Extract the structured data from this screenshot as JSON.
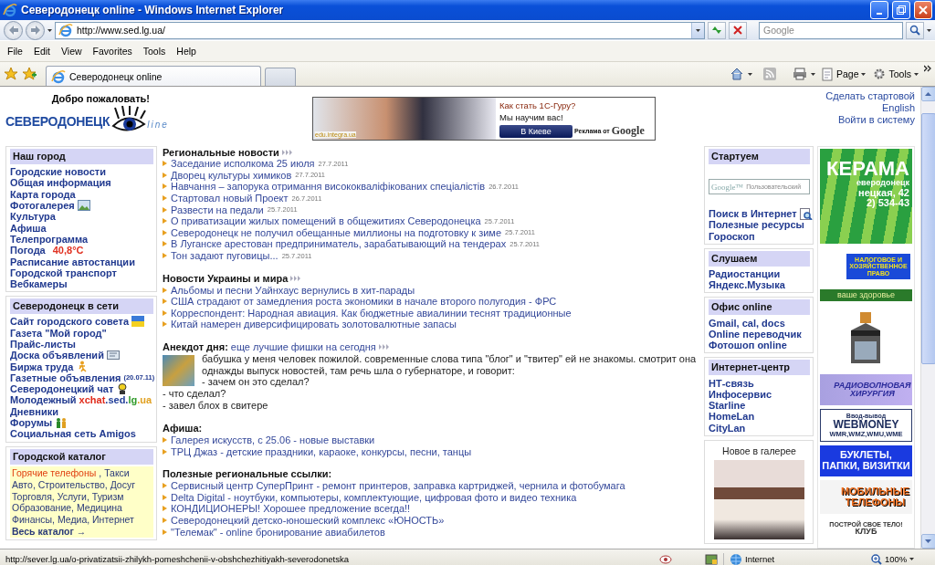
{
  "window": {
    "title": "Северодонецк online - Windows Internet Explorer"
  },
  "address_bar": {
    "url": "http://www.sed.lg.ua/"
  },
  "search": {
    "placeholder": "Google"
  },
  "menu": [
    "File",
    "Edit",
    "View",
    "Favorites",
    "Tools",
    "Help"
  ],
  "tabs": [
    {
      "label": "Северодонецк online",
      "selected": true
    }
  ],
  "command_bar": [
    "Page",
    "Tools"
  ],
  "header": {
    "welcome": "Добро пожаловать!",
    "logo": "СЕВЕРОДОНЕЦК",
    "logo_suffix": "line",
    "ad": {
      "site": "edu.integra.ua",
      "headline": "Как стать 1С-Гуру?",
      "subline": "Мы научим вас!",
      "button": "В Киеве",
      "ads_by": "Реклама от",
      "brand": "Google"
    },
    "links": [
      "Сделать стартовой",
      "English",
      "Войти в систему"
    ]
  },
  "left_sidebar": [
    {
      "title": "Наш город",
      "kind": "links",
      "items": [
        {
          "text": "Городские новости"
        },
        {
          "text": "Общая информация"
        },
        {
          "text": "Карта города"
        },
        {
          "text": "Фотогалерея"
        },
        {
          "text": "Культура"
        },
        {
          "text": "Афиша"
        },
        {
          "text": "Телепрограмма"
        },
        {
          "text": "Погода",
          "value": "40,8°C"
        },
        {
          "text": "Расписание автостанции"
        },
        {
          "text": "Городской транспорт"
        },
        {
          "text": "Вебкамеры"
        }
      ]
    },
    {
      "title": "Северодонецк в сети",
      "kind": "links",
      "items": [
        {
          "text": "Сайт городского совета"
        },
        {
          "text": "Газета \"Мой город\""
        },
        {
          "text": "Прайс-листы"
        },
        {
          "text": "Доска объявлений"
        },
        {
          "text": "Биржа труда"
        },
        {
          "text": "Газетные объявления",
          "note": "(20.07.11)"
        },
        {
          "text": "Северодонецкий чат"
        },
        {
          "text": "Молодежный",
          "parts": [
            {
              "text": "xchat",
              "color": "#e02a1a"
            },
            {
              "text": ".sed.",
              "color": "#23409a"
            },
            {
              "text": "lg",
              "color": "#2f9a2a"
            },
            {
              "text": ".ua",
              "color": "#e0a020"
            }
          ]
        },
        {
          "text": "Дневники"
        },
        {
          "text": "Форумы"
        },
        {
          "text": "Социальная сеть Amigos"
        }
      ]
    },
    {
      "title": "Городской каталог",
      "kind": "catalog",
      "lines": [
        [
          {
            "text": "Горячие телефоны",
            "hot": true
          },
          {
            "text": ", Такси",
            "hot": false
          }
        ],
        [
          {
            "text": "Авто, Строительство, Досуг",
            "hot": false
          }
        ],
        [
          {
            "text": "Торговля, Услуги, Туризм",
            "hot": false
          }
        ],
        [
          {
            "text": "Образование, Медицина",
            "hot": false
          }
        ],
        [
          {
            "text": "Финансы, Медиа, Интернет",
            "hot": false
          }
        ]
      ],
      "all": "Весь каталог →"
    }
  ],
  "center": [
    {
      "title": "Региональные новости",
      "more": true,
      "kind": "news",
      "items": [
        {
          "text": "Заседание исполкома 25 июля",
          "date": "27.7.2011"
        },
        {
          "text": "Дворец культуры химиков",
          "date": "27.7.2011"
        },
        {
          "text": "Навчання – запорука отримання висококваліфікованих спеціалістів",
          "date": "26.7.2011"
        },
        {
          "text": "Стартовал новый Проект",
          "date": "26.7.2011"
        },
        {
          "text": "Развести на педали",
          "date": "25.7.2011"
        },
        {
          "text": "О приватизации жилых помещений в общежитиях Северодонецка",
          "date": "25.7.2011"
        },
        {
          "text": "Северодонецк не получил обещанные миллионы на подготовку к зиме",
          "date": "25.7.2011"
        },
        {
          "text": "В Луганске арестован предприниматель, зарабатывающий на тендерах",
          "date": "25.7.2011"
        },
        {
          "text": "Тон задают пуговицы...",
          "date": "25.7.2011"
        }
      ]
    },
    {
      "title": "Новости Украины и мира",
      "more": true,
      "kind": "news",
      "items": [
        {
          "text": "Альбомы и песни Уайнхаус вернулись в хит-парады"
        },
        {
          "text": "США страдают от замедления роста экономики в начале второго полугодия - ФРС"
        },
        {
          "text": "Корреспондент: Народная авиация. Как бюджетные авиалинии теснят традиционные"
        },
        {
          "text": "Китай намерен диверсифицировать золотовалютные запасы"
        }
      ]
    },
    {
      "title": "Анекдот дня:",
      "more": true,
      "kind": "anecdote",
      "link": "еще лучшие фишки на сегодня",
      "lines": [
        "бабушка у меня человек пожилой. современные слова типа \"блог\" и \"твитер\" ей не знакомы. смотрит она однажды выпуск новостей, там речь шла о губернаторе, и говорит:",
        "- зачем он это сделал?",
        "- что сделал?",
        "- завел блох в свитере"
      ]
    },
    {
      "title": "Афиша:",
      "more": false,
      "kind": "news",
      "items": [
        {
          "text": "Галерея искусств, с 25.06 - новые выставки"
        },
        {
          "text": "ТРЦ Джаз - детские праздники, караоке, конкурсы, песни, танцы"
        }
      ]
    },
    {
      "title": "Полезные региональные ссылки:",
      "more": false,
      "kind": "news",
      "items": [
        {
          "text": "Сервисный центр СуперПринт - ремонт принтеров, заправка картриджей, чернила и фотобумага"
        },
        {
          "text": "Delta Digital - ноутбуки, компьютеры, комплектующие, цифровая фото и видео техника"
        },
        {
          "text": "КОНДИЦИОНЕРЫ! Хорошее предложение всегда!!"
        },
        {
          "text": "Северодонецкий детско-юношеский комплекс «ЮНОСТЬ»"
        },
        {
          "text": "\"Телемак\" - online бронирование авиабилетов"
        }
      ]
    }
  ],
  "right_sidebar": [
    {
      "title": "Стартуем",
      "kind": "search",
      "search": {
        "logo": "Google™",
        "placeholder": "Пользовательский"
      },
      "items": [
        {
          "text": "Поиск в Интернет"
        },
        {
          "text": "Полезные ресурсы"
        },
        {
          "text": "Гороскоп"
        }
      ]
    },
    {
      "title": "Слушаем",
      "kind": "links",
      "items": [
        {
          "text": "Радиостанции"
        },
        {
          "text": "Яндекс.Музыка"
        }
      ]
    },
    {
      "title": "Офис online",
      "kind": "links",
      "items": [
        {
          "text": "Gmail, cal, docs"
        },
        {
          "text": "Online переводчик"
        },
        {
          "text": "Фотошоп online"
        }
      ]
    },
    {
      "title": "Интернет-центр",
      "kind": "links",
      "items": [
        {
          "text": "НТ-связь"
        },
        {
          "text": "Инфосервис"
        },
        {
          "text": "Starline"
        },
        {
          "text": "HomeLan"
        },
        {
          "text": "CityLan"
        }
      ]
    },
    {
      "title": "Новое в галерее",
      "kind": "gallery"
    }
  ],
  "banners": [
    {
      "kind": "tiles",
      "texts": [
        "КЕРАМА",
        "еверодонецк",
        "нецкая, 42",
        "2) 534-43"
      ]
    },
    {
      "kind": "law",
      "texts": [
        "НАЛОГОВОЕ И ХОЗЯЙСТВЕННОЕ ПРАВО"
      ]
    },
    {
      "kind": "health",
      "texts": [
        "ваше здоровье"
      ]
    },
    {
      "kind": "building"
    },
    {
      "kind": "surgery",
      "texts": [
        "РАДИОВОЛНОВАЯ ХИРУРГИЯ"
      ]
    },
    {
      "kind": "webmoney",
      "texts": [
        "Ввод-вывод",
        "WEBMONEY",
        "WMR,WMZ,WMU,WME"
      ]
    },
    {
      "kind": "print",
      "texts": [
        "БУКЛЕТЫ, ПАПКИ, ВИЗИТКИ"
      ]
    },
    {
      "kind": "phones",
      "texts": [
        "МОБИЛЬНЫЕ ТЕЛЕФОНЫ"
      ]
    },
    {
      "kind": "club",
      "texts": [
        "ПОСТРОЙ СВОЕ ТЕЛО!",
        "КЛУБ"
      ]
    }
  ],
  "status_bar": {
    "url": "http://sever.lg.ua/o-privatizatsii-zhilykh-pomeshchenii-v-obshchezhitiyakh-severodonetska",
    "zone": "Internet",
    "zoom": "100%"
  }
}
